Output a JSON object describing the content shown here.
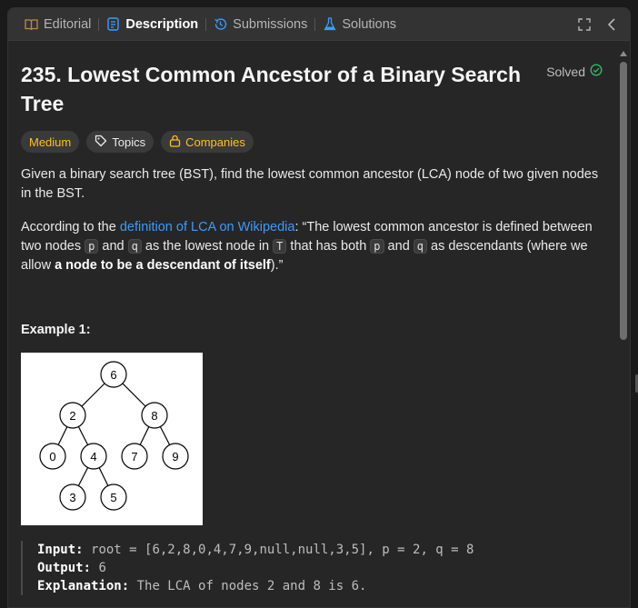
{
  "tabs": [
    {
      "label": "Editorial",
      "icon": "book-icon"
    },
    {
      "label": "Description",
      "icon": "document-icon"
    },
    {
      "label": "Submissions",
      "icon": "history-icon"
    },
    {
      "label": "Solutions",
      "icon": "flask-icon"
    }
  ],
  "toolbar": {
    "expand_icon": "expand-icon",
    "collapse_icon": "chevron-left-icon"
  },
  "problem": {
    "title": "235. Lowest Common Ancestor of a Binary Search Tree",
    "status": "Solved",
    "difficulty": "Medium",
    "topics_label": "Topics",
    "companies_label": "Companies",
    "intro": "Given a binary search tree (BST), find the lowest common ancestor (LCA) node of two given nodes in the BST.",
    "def_prefix": "According to the ",
    "def_link": "definition of LCA on Wikipedia",
    "def_text_1": ": “The lowest common ancestor is defined between two nodes ",
    "def_p": "p",
    "def_and": " and ",
    "def_q": "q",
    "def_text_2": " as the lowest node in ",
    "def_T": "T",
    "def_text_3": " that has both ",
    "def_text_4": " as descendants (where we allow ",
    "def_bold": "a node to be a descendant of itself",
    "def_end": ").”"
  },
  "example1": {
    "title": "Example 1:",
    "tree_nodes": [
      "6",
      "2",
      "8",
      "0",
      "4",
      "7",
      "9",
      "3",
      "5"
    ],
    "input_label": "Input:",
    "input_value": "root = [6,2,8,0,4,7,9,null,null,3,5], p = 2, q = 8",
    "output_label": "Output:",
    "output_value": "6",
    "explanation_label": "Explanation:",
    "explanation_value": "The LCA of nodes 2 and 8 is 6."
  },
  "colors": {
    "accent": "#3a9bff",
    "medium": "#ffc01e",
    "solved": "#2cbb5d"
  }
}
